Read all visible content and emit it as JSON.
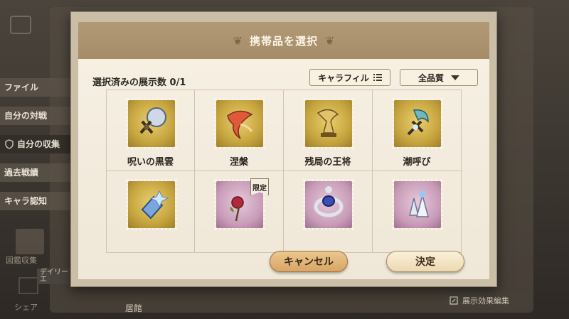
{
  "dialog": {
    "title": "携帯品を選択",
    "selected_count_label": "選択済みの展示数 0/1",
    "filter_button": "キャラフィル",
    "quality_select": "全品質",
    "cancel_button": "キャンセル",
    "confirm_button": "決定"
  },
  "items": [
    {
      "name": "呪いの黒雲",
      "rarity": "gold",
      "icon": "cursed-cloud-icon"
    },
    {
      "name": "涅槃",
      "rarity": "gold",
      "icon": "phoenix-icon"
    },
    {
      "name": "残局の王将",
      "rarity": "gold",
      "icon": "chess-king-icon"
    },
    {
      "name": "潮呼び",
      "rarity": "gold",
      "icon": "tide-caller-icon"
    },
    {
      "name": "",
      "rarity": "gold",
      "icon": "crystal-bottle-icon"
    },
    {
      "name": "",
      "rarity": "purple",
      "icon": "rose-icon",
      "badge": "限定"
    },
    {
      "name": "",
      "rarity": "purple",
      "icon": "sapphire-ring-icon"
    },
    {
      "name": "",
      "rarity": "purple",
      "icon": "crystal-cluster-icon"
    }
  ],
  "background": {
    "side_nav": [
      "ファイル",
      "自分の対戦",
      "自分の収集",
      "過去戦績",
      "キャラ認知"
    ],
    "gallery_label": "図鑑収集",
    "share_label": "シェア",
    "daily_tag": "デイリー\nエ",
    "residence_label": "居館",
    "effect_button": "展示効果編集"
  },
  "colors": {
    "title_bar": "#a58b67",
    "paper": "#f5eee0",
    "gold_stamp": "#c7a640",
    "purple_stamp": "#c89bb7",
    "cancel_button": "#d8a565",
    "confirm_button": "#f0dfbd"
  }
}
